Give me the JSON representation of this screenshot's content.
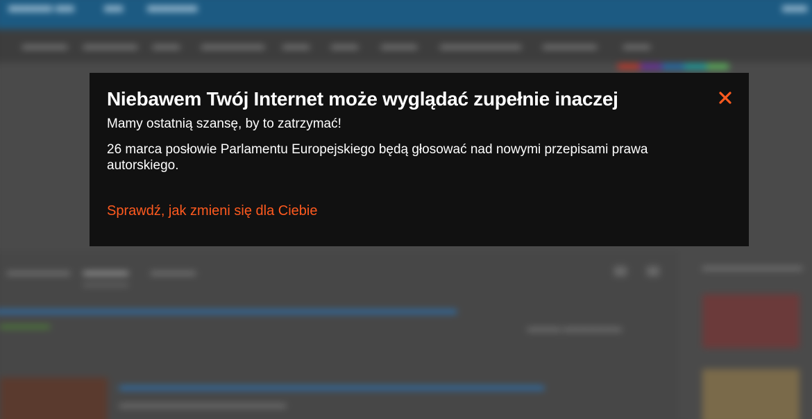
{
  "modal": {
    "title": "Niebawem Twój Internet może wyglądać zupełnie inaczej",
    "subtitle": "Mamy ostatnią szansę, by to zatrzymać!",
    "body": "26 marca posłowie Parlamentu Europejskiego będą głosować nad nowymi przepisami prawa autorskiego.",
    "link_label": "Sprawdź, jak zmieni się dla Ciebie",
    "close_icon": "close-icon",
    "accent_color": "#ff5a1f",
    "background_color": "#111111"
  }
}
